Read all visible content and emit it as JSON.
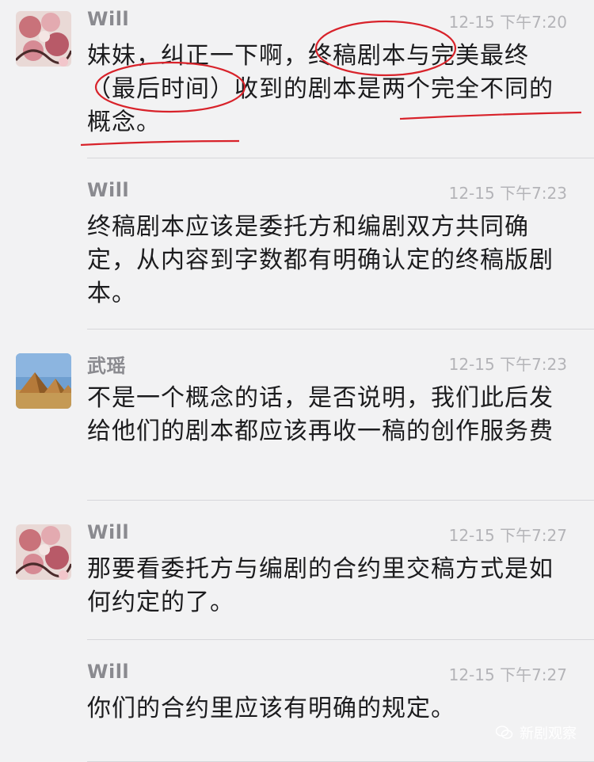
{
  "messages": [
    {
      "sender": "Will",
      "time": "12-15 下午7:20",
      "text": "妹妹，纠正一下啊，终稿剧本与完美最终（最后时间）收到的剧本是两个完全不同的概念。",
      "avatar_icon": "flower-avatar-icon",
      "show_avatar": true
    },
    {
      "sender": "Will",
      "time": "12-15 下午7:23",
      "text": "终稿剧本应该是委托方和编剧双方共同确定，从内容到字数都有明确认定的终稿版剧本。",
      "show_avatar": false
    },
    {
      "sender": "武瑶",
      "time": "12-15 下午7:23",
      "text": "不是一个概念的话，是否说明，我们此后发给他们的剧本都应该再收一稿的创作服务费",
      "avatar_icon": "pyramid-avatar-icon",
      "show_avatar": true
    },
    {
      "sender": "Will",
      "time": "12-15 下午7:27",
      "text": "那要看委托方与编剧的合约里交稿方式是如何约定的了。",
      "avatar_icon": "flower-avatar-icon",
      "show_avatar": true
    },
    {
      "sender": "Will",
      "time": "12-15 下午7:27",
      "text": "你们的合约里应该有明确的规定。",
      "show_avatar": false
    }
  ],
  "watermark": {
    "label": "新剧观察",
    "icon": "wechat-icon"
  },
  "colors": {
    "background": "#f2f2f3",
    "name": "#8a8a8f",
    "time": "#b4b4b8",
    "annotation": "#d8222a"
  }
}
